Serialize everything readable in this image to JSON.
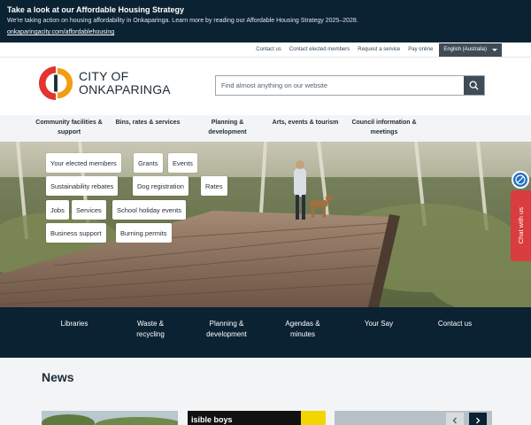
{
  "alert": {
    "title": "Take a look at our Affordable Housing Strategy",
    "text": "We're taking action on housing affordability in Onkaparinga. Learn more by reading our Affordable Housing Strategy 2025–2028.",
    "link": "onkaparingacity.com/affordablehousing"
  },
  "utility": {
    "links": [
      "Contact us",
      "Contact elected members",
      "Request a service",
      "Pay online"
    ],
    "language": "English (Australia)"
  },
  "logo": {
    "line1": "CITY OF",
    "line2": "ONKAPARINGA",
    "colors": {
      "red": "#e3342f",
      "orange": "#f39c12",
      "navy": "#1d2b36"
    }
  },
  "search": {
    "placeholder": "Find almost anything on our website",
    "icon": "search-icon"
  },
  "mainnav": [
    {
      "line1": "Community facilities &",
      "line2": "support"
    },
    {
      "line1": "Bins, rates & services",
      "line2": ""
    },
    {
      "line1": "Planning &",
      "line2": "development"
    },
    {
      "line1": "Arts, events & tourism",
      "line2": ""
    },
    {
      "line1": "Council information &",
      "line2": "meetings"
    }
  ],
  "quicklinks": [
    "Your elected members",
    "Grants",
    "Events",
    "Sustainability rebates",
    "Dog registration",
    "Rates",
    "Jobs",
    "Services",
    "School holiday events",
    "Business support",
    "Burning permits"
  ],
  "chat": {
    "label": "Chat with us",
    "icon": "chat-icon"
  },
  "accessibility": {
    "icon": "accessibility-icon"
  },
  "quickbar": [
    {
      "line1": "Libraries",
      "line2": ""
    },
    {
      "line1": "Waste &",
      "line2": "recycling"
    },
    {
      "line1": "Planning &",
      "line2": "development"
    },
    {
      "line1": "Agendas &",
      "line2": "minutes"
    },
    {
      "line1": "Your Say",
      "line2": ""
    },
    {
      "line1": "Contact us",
      "line2": ""
    }
  ],
  "news": {
    "title": "News",
    "card2_fragment": "isible boys"
  },
  "colors": {
    "navy": "#0b2233",
    "accent_red": "#d93d3d",
    "access_blue": "#1f6fc4"
  }
}
